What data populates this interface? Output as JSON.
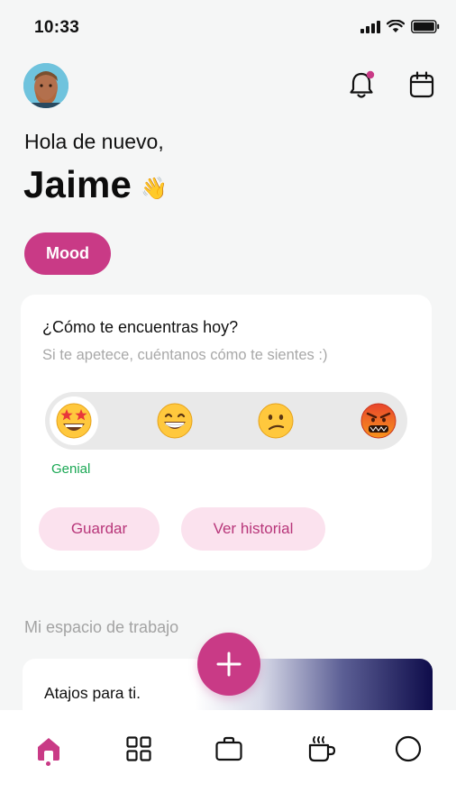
{
  "status_bar": {
    "time": "10:33"
  },
  "header": {
    "greeting": "Hola de nuevo,",
    "username": "Jaime",
    "wave_emoji": "👋",
    "icons": [
      "bell-icon",
      "calendar-icon"
    ]
  },
  "mood_button": {
    "label": "Mood"
  },
  "mood_card": {
    "question": "¿Cómo te encuentras hoy?",
    "subtitle": "Si te apetece, cuéntanos cómo te sientes :)",
    "selected_label": "Genial",
    "options": [
      {
        "icon": "star-struck-emoji",
        "selected": true
      },
      {
        "icon": "grinning-emoji",
        "selected": false
      },
      {
        "icon": "confused-emoji",
        "selected": false
      },
      {
        "icon": "angry-emoji",
        "selected": false
      }
    ],
    "buttons": {
      "save": "Guardar",
      "history": "Ver historial"
    }
  },
  "workspace": {
    "title": "Mi espacio de trabajo",
    "shortcuts_title": "Atajos para ti."
  },
  "bottom_nav": {
    "items": [
      "home-icon",
      "grid-icon",
      "briefcase-icon",
      "coffee-icon",
      "profile-icon"
    ],
    "active_index": 0
  },
  "colors": {
    "accent": "#c93a86",
    "accent_soft": "#fbe2ee",
    "positive": "#1aa854",
    "background": "#f5f6f6"
  }
}
